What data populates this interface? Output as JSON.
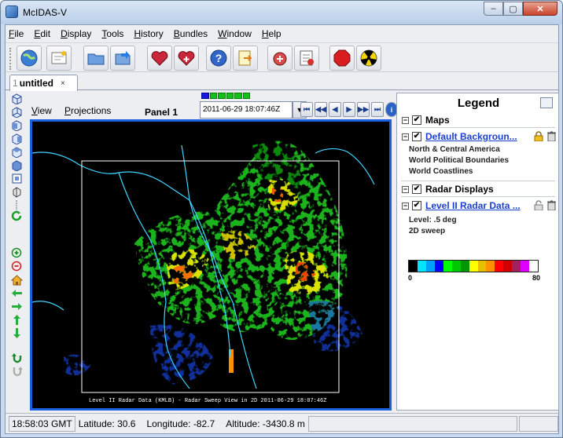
{
  "window": {
    "title": "McIDAS-V",
    "min_glyph": "–",
    "max_glyph": "▢",
    "close_glyph": "✕"
  },
  "menu": [
    "File",
    "Edit",
    "Display",
    "Tools",
    "History",
    "Bundles",
    "Window",
    "Help"
  ],
  "toolbar": [
    "globe-icon",
    "data-chooser-icon",
    "open-folder-icon",
    "save-bundle-icon",
    "favorite-heart-icon",
    "favorite-bundle-icon",
    "help-icon",
    "history-icon",
    "tools-icon",
    "log-icon",
    "stop-icon",
    "radiation-icon"
  ],
  "tab": {
    "number": "1",
    "label": "untitled",
    "close": "×"
  },
  "view": {
    "menu_view": "View",
    "menu_projections": "Projections",
    "panel_title": "Panel 1",
    "time": "2011-06-29 18:07:46Z",
    "anim_controls": [
      "⏮",
      "◀◀",
      "◀",
      "▶",
      "▶▶",
      "⏭",
      "i"
    ],
    "time_bar_steps": 6,
    "time_bar_current": 0
  },
  "map_caption": "Level II Radar Data (KMLB) - Radar Sweep View in 2D 2011-06-29 18:07:46Z",
  "legend": {
    "title": "Legend",
    "sections": [
      {
        "name": "Maps",
        "layers": [
          {
            "name": "Default Backgroun...",
            "details": [
              "North & Central America",
              "World Political Boundaries",
              "World Coastlines"
            ]
          }
        ]
      },
      {
        "name": "Radar Displays",
        "layers": [
          {
            "name": "Level II Radar Data ...",
            "details": [
              "Level: .5 deg",
              "2D sweep"
            ]
          }
        ]
      }
    ],
    "colorbar": {
      "min": "0",
      "max": "80",
      "colors": [
        "#000000",
        "#00e5ff",
        "#00a0ff",
        "#0000ff",
        "#00ff00",
        "#00c800",
        "#009600",
        "#ffff00",
        "#e6c000",
        "#ff9000",
        "#ff0000",
        "#d40000",
        "#a02060",
        "#e000ff",
        "#ffffff"
      ]
    }
  },
  "status": {
    "time": "18:58:03 GMT",
    "latitude": "Latitude:  30.6",
    "longitude": "Longitude: -82.7",
    "altitude": "Altitude: -3430.8 m"
  },
  "colors": {
    "frame_accent": "#1960e0",
    "coastline": "#3cd6ff"
  }
}
